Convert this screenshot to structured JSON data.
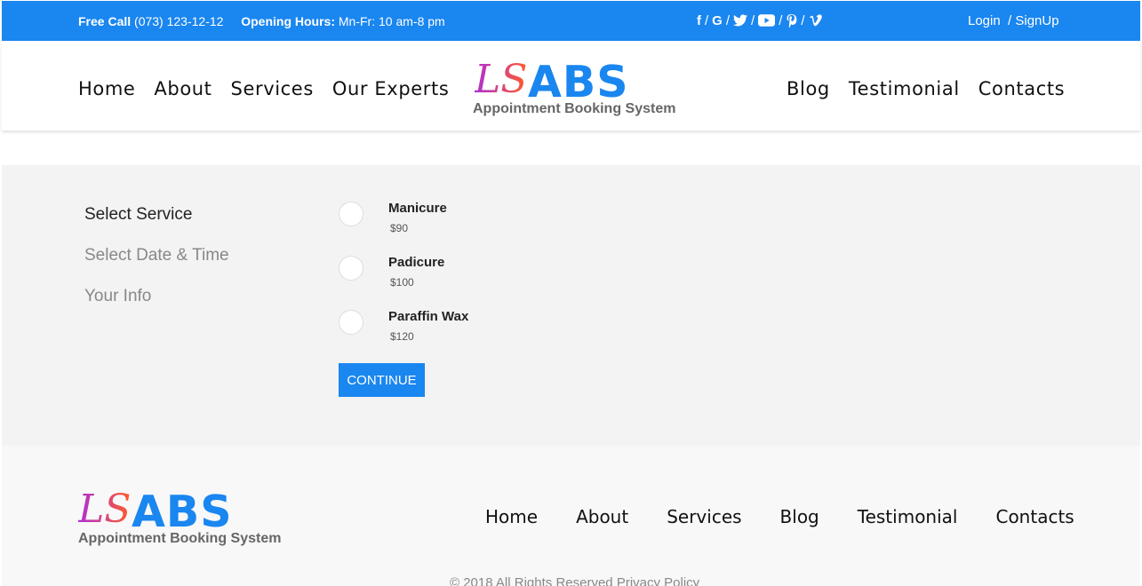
{
  "topbar": {
    "free_call_label": "Free Call",
    "phone": "(073) 123-12-12",
    "hours_label": "Opening Hours:",
    "hours": "Mn-Fr: 10 am-8 pm",
    "social_icons": [
      {
        "name": "facebook-icon",
        "glyph": "f"
      },
      {
        "name": "google-icon",
        "glyph": "G"
      },
      {
        "name": "twitter-icon",
        "glyph": "🐦"
      },
      {
        "name": "youtube-icon",
        "glyph": "▶"
      },
      {
        "name": "pinterest-icon",
        "glyph": "℘"
      },
      {
        "name": "vimeo-icon",
        "glyph": "V"
      }
    ],
    "social_separator": "/",
    "login": "Login",
    "signup": "/ SignUp"
  },
  "header": {
    "nav_left": [
      "Home",
      "About",
      "Services",
      "Our Experts"
    ],
    "nav_right": [
      "Blog",
      "Testimonial",
      "Contacts"
    ]
  },
  "logo": {
    "ls": "LS",
    "abs": "ABS",
    "tagline": "Appointment Booking System"
  },
  "booking": {
    "steps": [
      {
        "label": "Select Service",
        "active": true
      },
      {
        "label": "Select Date & Time",
        "active": false
      },
      {
        "label": "Your Info",
        "active": false
      }
    ],
    "services": [
      {
        "name": "Manicure",
        "price": "$90"
      },
      {
        "name": "Padicure",
        "price": "$100"
      },
      {
        "name": "Paraffin Wax",
        "price": "$120"
      }
    ],
    "continue_label": "CONTINUE"
  },
  "footer": {
    "nav": [
      "Home",
      "About",
      "Services",
      "Blog",
      "Testimonial",
      "Contacts"
    ],
    "copyright": "© 2018 All Rights Reserved Privacy Policy"
  },
  "colors": {
    "accent": "#1a86f0",
    "booking_bg": "#f3f3f3",
    "footer_bg": "#f8f8f8"
  }
}
